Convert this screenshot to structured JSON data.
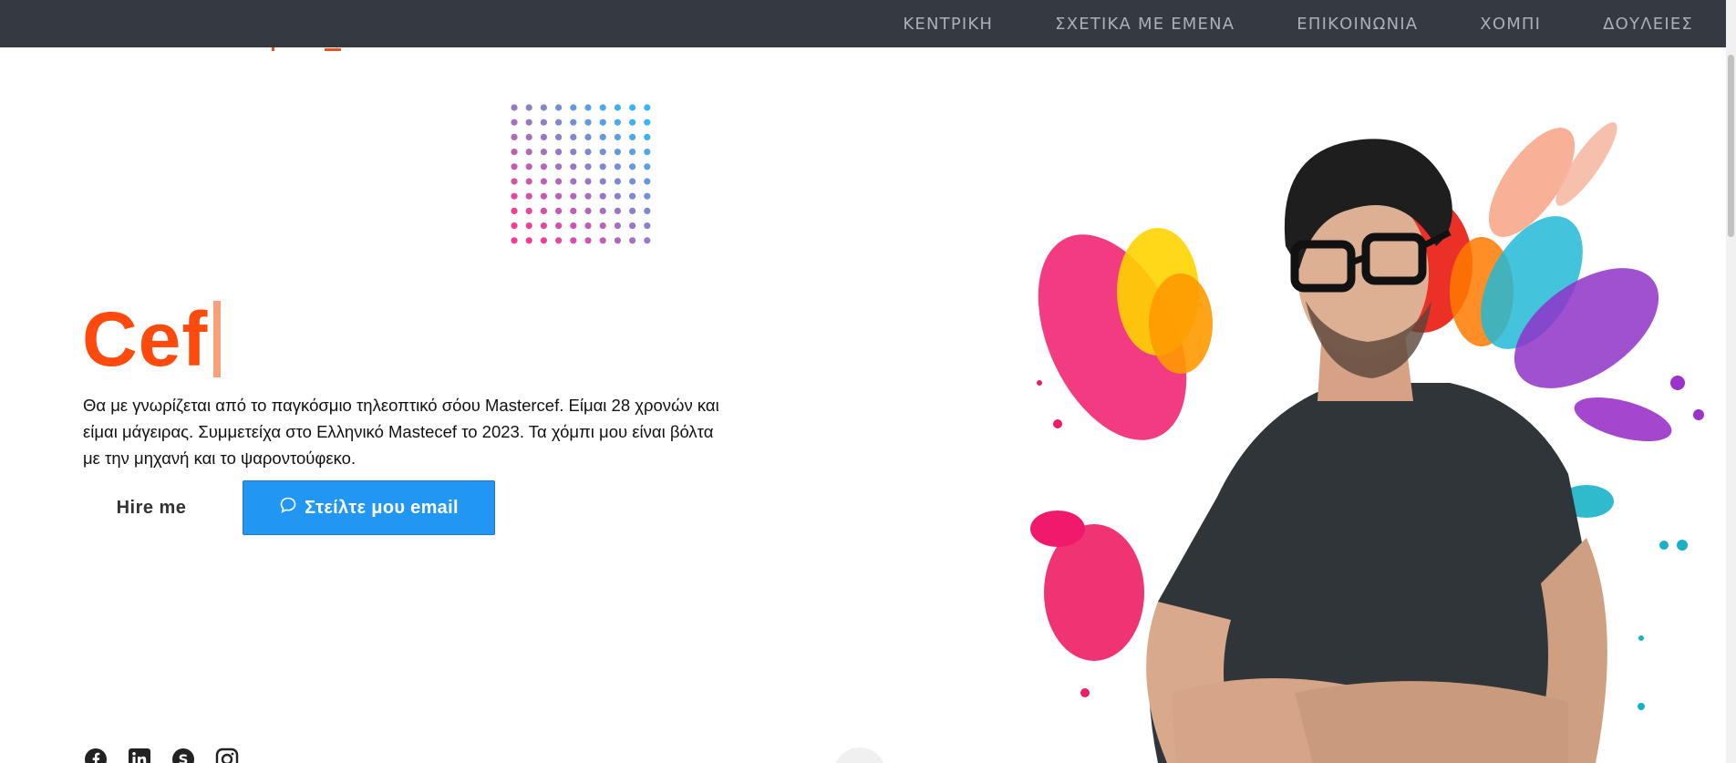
{
  "nav": {
    "items": [
      {
        "label": "ΚΕΝΤΡΙΚΗ"
      },
      {
        "label": "ΣΧΕΤΙΚΑ ΜΕ ΕΜΕΝΑ"
      },
      {
        "label": "ΕΠΙΚΟΙΝΩΝΙΑ"
      },
      {
        "label": "ΧΟΜΠΙ"
      },
      {
        "label": "ΔΟΥΛΕΙΕΣ"
      }
    ]
  },
  "hero": {
    "title": "Cef",
    "description": "Θα με γνωρίζεται από το παγκόσμιο τηλεοπτικό σόου Mastercef. Είμαι 28 χρονών και είμαι μάγειρας. Συμμετείχα στο Ελληνικό Mastecef το 2023. Τα χόμπι μου είναι βόλτα με την μηχανή και το ψαροντούφεκο.",
    "hire_label": "Hire me",
    "email_label": "Στείλτε μου email"
  },
  "socials": [
    {
      "icon": "facebook-icon"
    },
    {
      "icon": "linkedin-icon"
    },
    {
      "icon": "skype-icon"
    },
    {
      "icon": "instagram-icon"
    }
  ],
  "colors": {
    "topbar": "#343a40",
    "nav_text": "#aab0b6",
    "accent": "#ff4a0d",
    "button_blue": "#2196f3"
  }
}
